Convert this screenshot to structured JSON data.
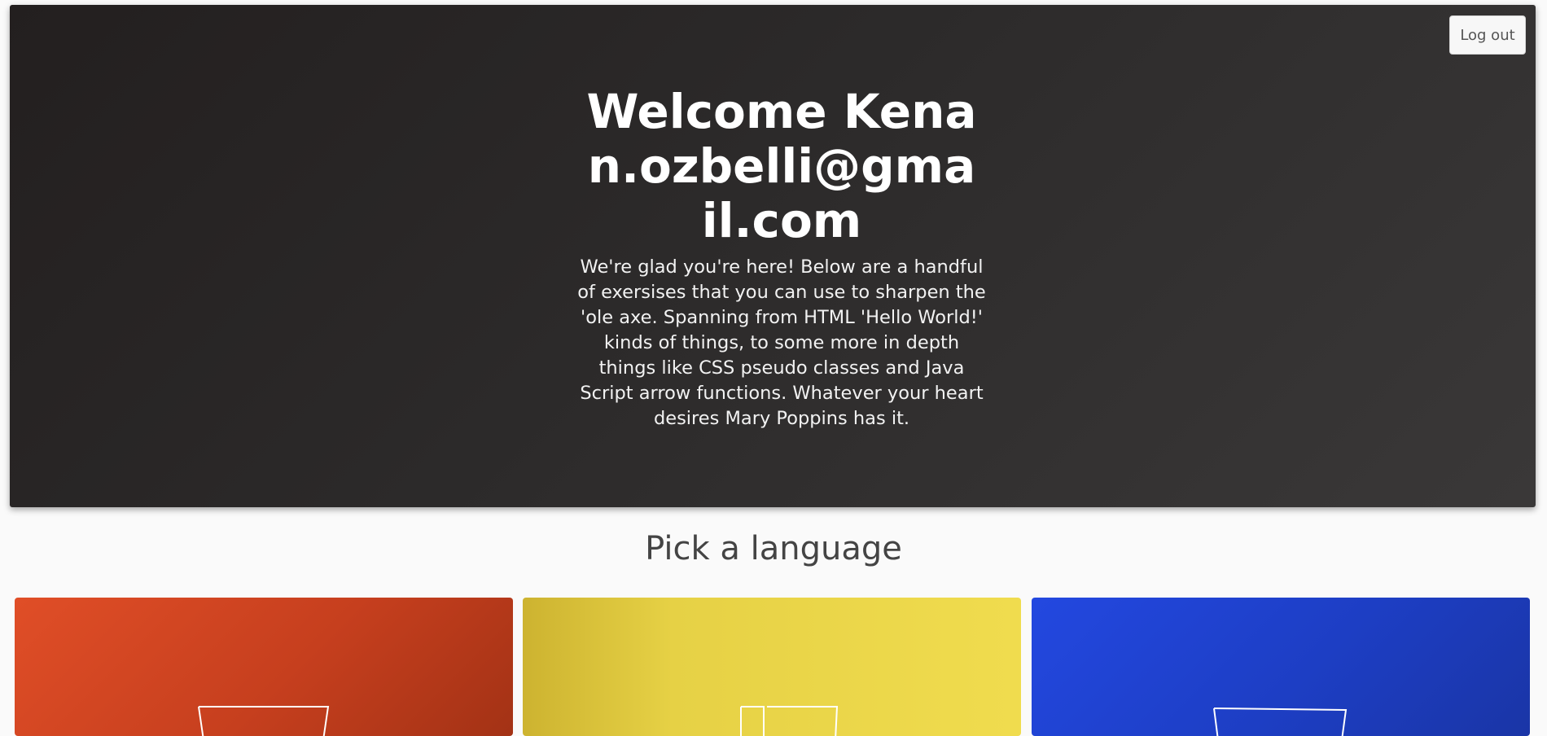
{
  "header": {
    "logout_label": "Log out",
    "title": "Welcome Kenan.ozbelli@gmail.com",
    "description": "We're glad you're here! Below are a handful of exersises that you can use to sharpen the 'ole axe. Spanning from HTML 'Hello World!' kinds of things, to some more in depth things like CSS pseudo classes and Java Script arrow functions. Whatever your heart desires Mary Poppins has it."
  },
  "languages": {
    "heading": "Pick a language",
    "cards": [
      {
        "icon": "html5-shield-icon",
        "color": "#d8471f"
      },
      {
        "icon": "js-shield-icon",
        "color": "#e8d547"
      },
      {
        "icon": "css3-shield-icon",
        "color": "#2145d4"
      }
    ]
  }
}
